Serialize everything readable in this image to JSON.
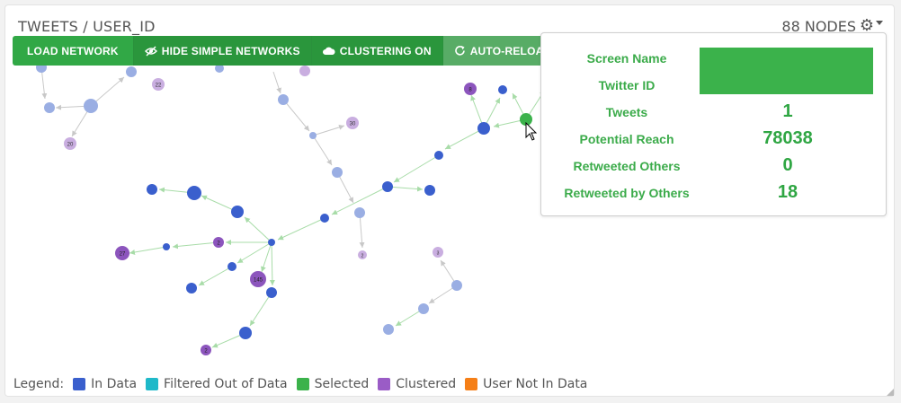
{
  "panel": {
    "title": "TWEETS / USER_ID",
    "node_count": "88 NODES"
  },
  "toolbar": {
    "load_label": "LOAD NETWORK",
    "hide_label": "HIDE SIMPLE NETWORKS",
    "cluster_label": "CLUSTERING ON",
    "reload_label": "AUTO-RELOAD ON"
  },
  "tooltip": {
    "rows": [
      {
        "label": "Screen Name",
        "value": ""
      },
      {
        "label": "Twitter ID",
        "value": ""
      },
      {
        "label": "Tweets",
        "value": "1"
      },
      {
        "label": "Potential Reach",
        "value": "78038"
      },
      {
        "label": "Retweeted Others",
        "value": "0"
      },
      {
        "label": "Retweeted by Others",
        "value": "18"
      }
    ]
  },
  "legend": {
    "prefix": "Legend:",
    "items": [
      {
        "label": "In Data",
        "color": "#3a5fcd"
      },
      {
        "label": "Filtered Out of Data",
        "color": "#1fb9c9"
      },
      {
        "label": "Selected",
        "color": "#3bb24b"
      },
      {
        "label": "Clustered",
        "color": "#9a5cc6"
      },
      {
        "label": "User Not In Data",
        "color": "#f57f17"
      }
    ]
  },
  "colors": {
    "in_data": "#3a5fcd",
    "in_data_light": "#9aaee3",
    "selected": "#3bb24b",
    "clustered": "#8c55bd",
    "clustered_light": "#c9aee0",
    "edge_green": "#a8dca8",
    "edge_gray": "#c8c8c8"
  },
  "graph": {
    "node_labels": [
      "22",
      "20",
      "30",
      "8",
      "27",
      "2",
      "145",
      "2",
      "2",
      "3"
    ]
  }
}
